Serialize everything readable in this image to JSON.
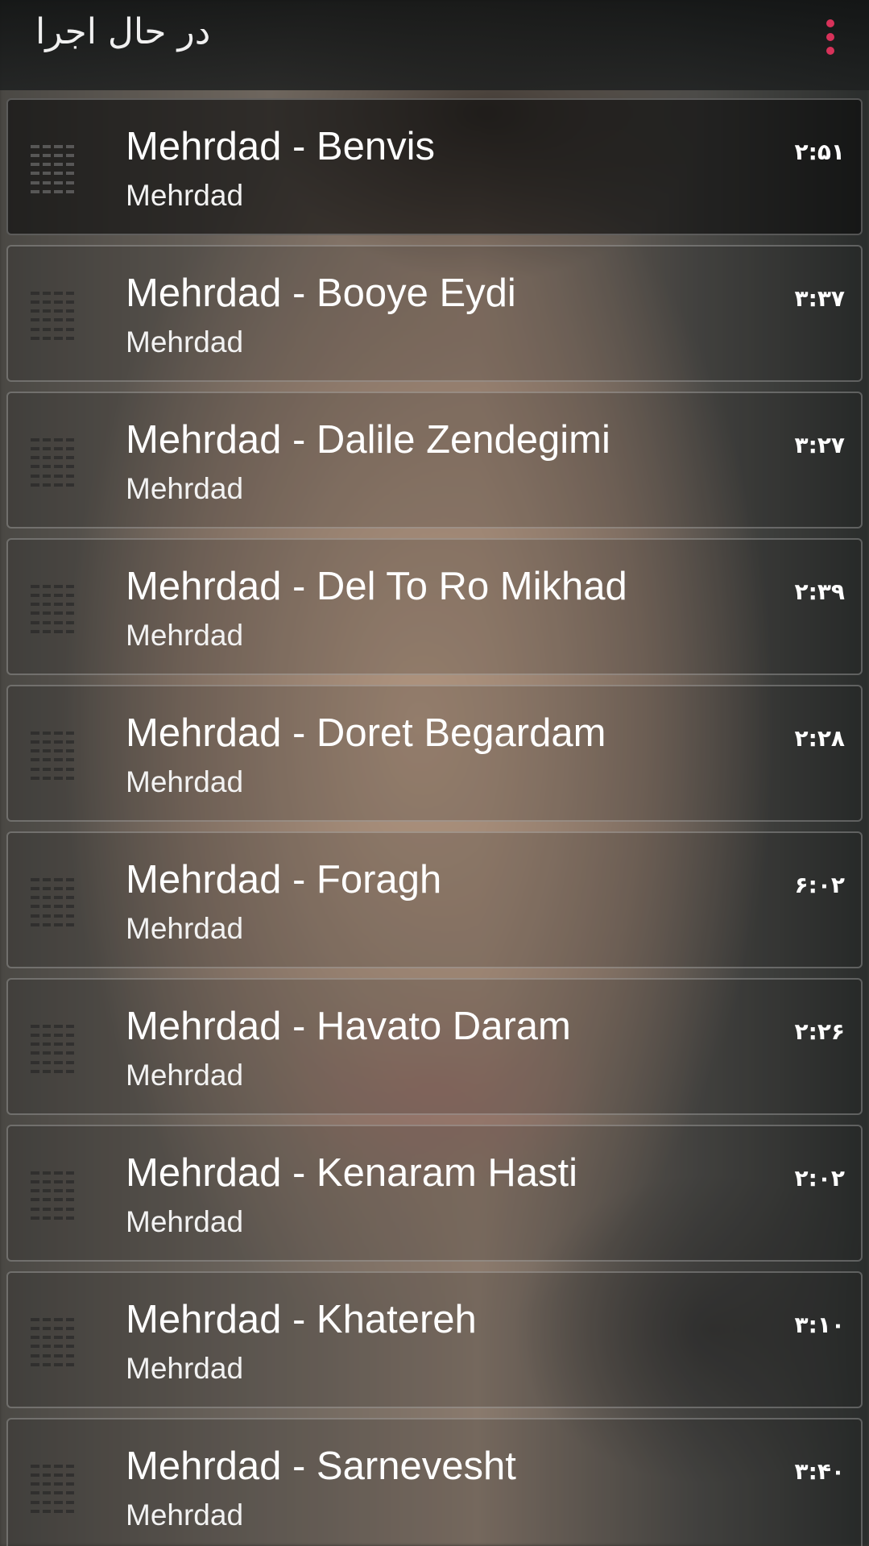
{
  "header": {
    "title": "در حال اجرا",
    "menu_icon": "more-vert-icon",
    "accent_color": "#d8325a"
  },
  "playlist": {
    "items": [
      {
        "title": "Mehrdad - Benvis",
        "artist": "Mehrdad",
        "duration": "۲:۵۱"
      },
      {
        "title": "Mehrdad - Booye Eydi",
        "artist": "Mehrdad",
        "duration": "۳:۳۷"
      },
      {
        "title": "Mehrdad - Dalile Zendegimi",
        "artist": "Mehrdad",
        "duration": "۳:۲۷"
      },
      {
        "title": "Mehrdad - Del To Ro Mikhad",
        "artist": "Mehrdad",
        "duration": "۲:۳۹"
      },
      {
        "title": "Mehrdad - Doret Begardam",
        "artist": "Mehrdad",
        "duration": "۲:۲۸"
      },
      {
        "title": "Mehrdad - Foragh",
        "artist": "Mehrdad",
        "duration": "۶:۰۲"
      },
      {
        "title": "Mehrdad - Havato Daram",
        "artist": "Mehrdad",
        "duration": "۲:۲۶"
      },
      {
        "title": "Mehrdad - Kenaram Hasti",
        "artist": "Mehrdad",
        "duration": "۲:۰۲"
      },
      {
        "title": "Mehrdad - Khatereh",
        "artist": "Mehrdad",
        "duration": "۳:۱۰"
      },
      {
        "title": "Mehrdad - Sarnevesht",
        "artist": "Mehrdad",
        "duration": "۳:۴۰"
      }
    ],
    "handle_icon": "drag-handle-icon"
  }
}
